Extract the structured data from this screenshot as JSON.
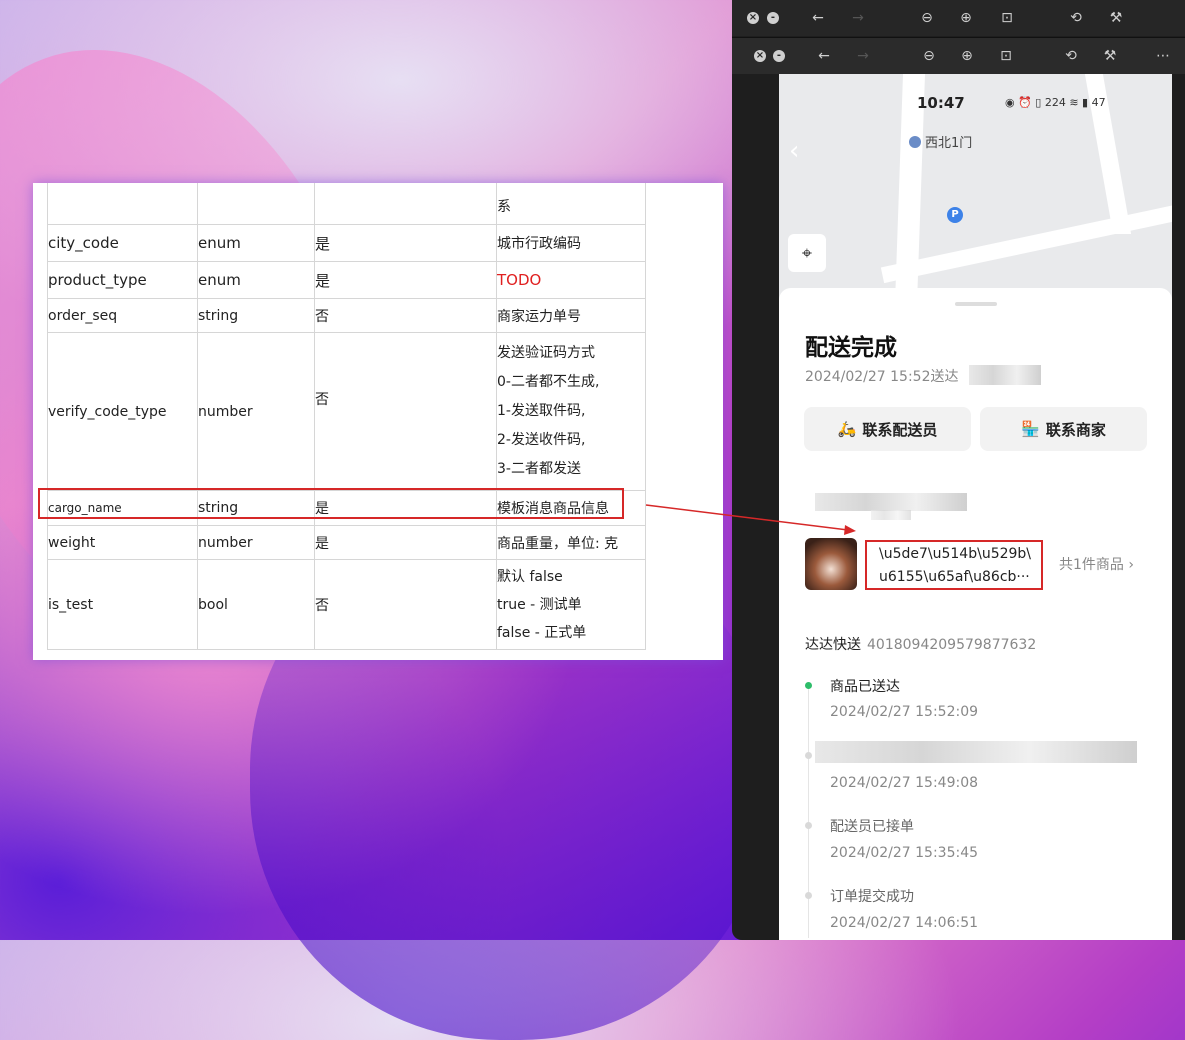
{
  "doc": {
    "rows": [
      {
        "name": "",
        "type": "",
        "required": "",
        "desc": [
          "系"
        ]
      },
      {
        "name": "city_code",
        "type": "enum",
        "required": "是",
        "desc": [
          "城市行政编码"
        ]
      },
      {
        "name": "product_type",
        "type": "enum",
        "required": "是",
        "desc": [
          "TODO"
        ]
      },
      {
        "name": "order_seq",
        "type": "string",
        "required": "否",
        "desc": [
          "商家运力单号"
        ]
      },
      {
        "name": "verify_code_type",
        "type": "number",
        "required": "否",
        "desc": [
          "发送验证码方式",
          "0-二者都不生成,",
          "1-发送取件码,",
          "2-发送收件码,",
          "3-二者都发送"
        ]
      },
      {
        "name": "cargo_name",
        "type": "string",
        "required": "是",
        "desc": [
          "模板消息商品信息"
        ]
      },
      {
        "name": "weight",
        "type": "number",
        "required": "是",
        "desc": [
          "商品重量，单位: 克"
        ]
      },
      {
        "name": "is_test",
        "type": "bool",
        "required": "否",
        "desc": [
          "默认 false",
          "true - 测试单",
          "false - 正式单"
        ]
      }
    ]
  },
  "phone": {
    "time": "10:47",
    "status_icons": "◉ ⏰ ▯ 224 ≋ ▮ 47",
    "map_label": "西北1门",
    "parking": "P",
    "title": "配送完成",
    "subtitle": "2024/02/27 15:52送达",
    "btn_rider": "联系配送员",
    "btn_shop": "联系商家",
    "product_line1": "\\u5de7\\u514b\\u529b\\",
    "product_line2": "u6155\\u65af\\u86cb···",
    "product_count": "共1件商品",
    "carrier_name": "达达快送",
    "carrier_no": "4018094209579877632",
    "timeline": [
      {
        "title": "商品已送达",
        "time": "2024/02/27 15:52:09",
        "active": true
      },
      {
        "title": "",
        "time": "2024/02/27 15:49:08",
        "active": false
      },
      {
        "title": "配送员已接单",
        "time": "2024/02/27 15:35:45",
        "active": false
      },
      {
        "title": "订单提交成功",
        "time": "2024/02/27 14:06:51",
        "active": false
      }
    ]
  },
  "colors": {
    "highlight": "#d62828",
    "accent_green": "#2ebd6a"
  }
}
